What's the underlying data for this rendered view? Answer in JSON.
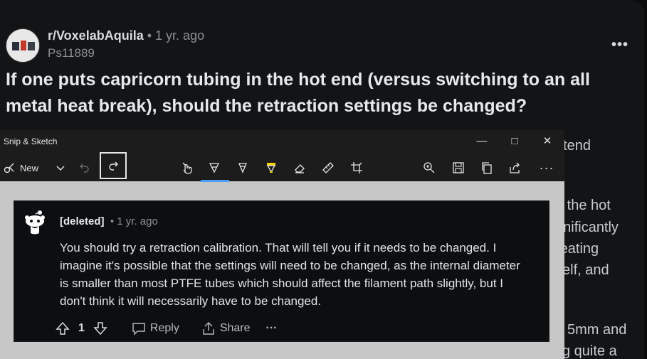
{
  "post": {
    "subreddit": "r/VoxelabAquila",
    "separator": "•",
    "age": "1 yr. ago",
    "username": "Ps11889",
    "title": "If one puts capricorn tubing in the hot end (versus switching to an all metal heat break), should the retraction settings be changed?",
    "more_icon": "more-dots-icon",
    "background_snippets": [
      "otend",
      "o the hot",
      "gnificantly",
      "reating",
      "self, and",
      "5mm and",
      "g quite a"
    ]
  },
  "snip_window": {
    "title": "Snip & Sketch",
    "new_label": "New",
    "tools": [
      "undo-icon",
      "redo-icon",
      "touch-writing-icon",
      "ballpoint-pen-icon",
      "pencil-icon",
      "highlighter-icon",
      "eraser-icon",
      "ruler-icon",
      "crop-icon",
      "zoom-icon",
      "save-icon",
      "copy-icon",
      "share-icon",
      "more-icon"
    ],
    "colors": {
      "titlebar": "#1c1c1c",
      "canvas": "#c7c7c7",
      "accent": "#4a9eff",
      "highlighter": "#f5d300"
    }
  },
  "comment": {
    "user": "[deleted]",
    "separator": "•",
    "age": "1 yr. ago",
    "body": "You should try a retraction calibration. That will tell you if it needs to be changed. I imagine it's possible that the settings will need to be changed, as the internal diameter is smaller than most PTFE tubes which should affect the filament path slightly, but I don't think it will necessarily have to be changed.",
    "votes": "1",
    "reply_label": "Reply",
    "share_label": "Share",
    "more_label": "···"
  }
}
